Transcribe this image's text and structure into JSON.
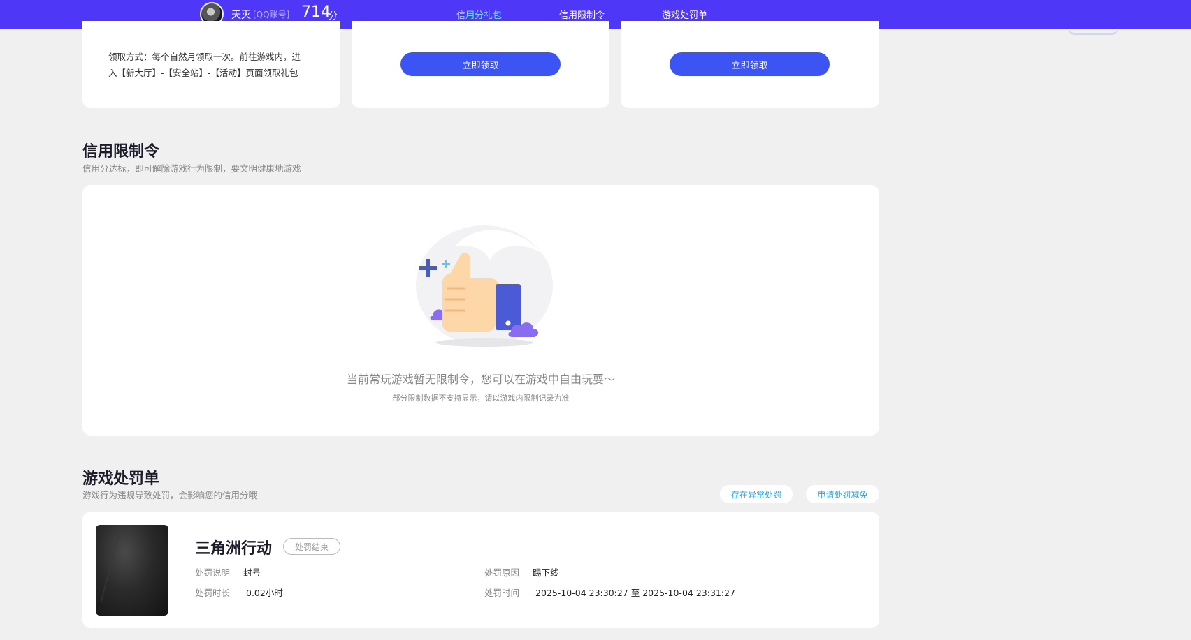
{
  "header": {
    "user_name": "天灭",
    "account_type": "[QQ账号]",
    "score": "714",
    "score_unit": "分",
    "tabs": [
      {
        "label": "信用分礼包",
        "active": true
      },
      {
        "label": "信用限制令",
        "active": false
      },
      {
        "label": "游戏处罚单",
        "active": false
      }
    ],
    "accent_color": "#4f37f7",
    "active_tab_color": "#74e1ff"
  },
  "gift_cards": {
    "claim_method_line1": "领取方式：每个自然月领取一次。前往游戏内，进",
    "claim_method_line2": "入【新大厅】-【安全站】-【活动】页面领取礼包",
    "claim_button_1": "立即领取",
    "claim_button_2": "立即领取"
  },
  "restriction": {
    "title": "信用限制令",
    "subtitle": "信用分达标，即可解除游戏行为限制，要文明健康地游戏",
    "empty_message": "当前常玩游戏暂无限制令，您可以在游戏中自由玩耍～",
    "empty_note": "部分限制数据不支持显示，请以游戏内限制记录为准",
    "illustration_icon": "thumbs-up-icon"
  },
  "penalty": {
    "title": "游戏处罚单",
    "subtitle": "游戏行为违规导致处罚，会影响您的信用分哦",
    "btn_abnormal": "存在异常处罚",
    "btn_appeal": "申请处罚减免",
    "record": {
      "game_name": "三角洲行动",
      "status": "处罚结束",
      "desc_label": "处罚说明",
      "desc_value": "封号",
      "reason_label": "处罚原因",
      "reason_value": "踢下线",
      "duration_label": "处罚时长",
      "duration_value": "0.02小时",
      "time_label": "处罚时间",
      "time_value": "2025-10-04 23:30:27 至 2025-10-04 23:31:27"
    }
  }
}
